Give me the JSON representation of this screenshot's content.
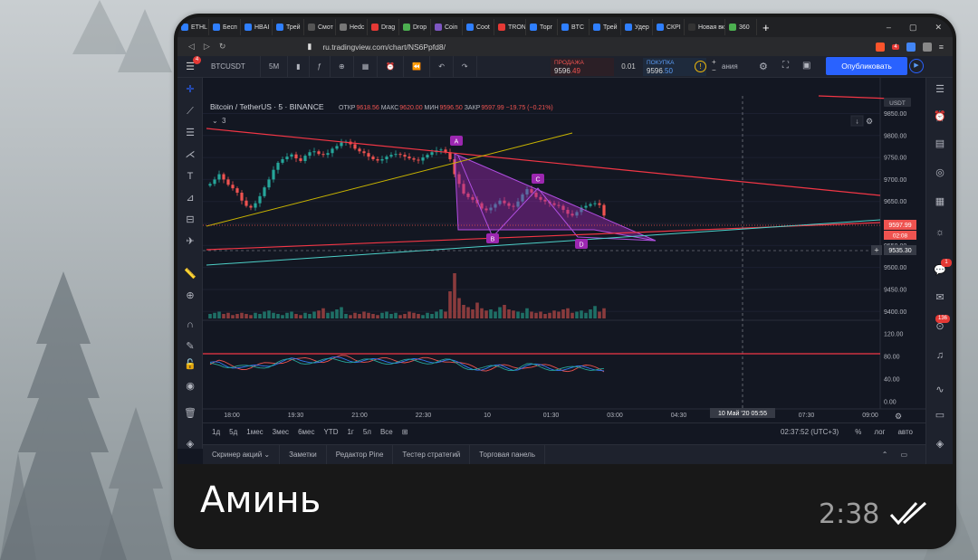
{
  "browser": {
    "tabs": [
      {
        "label": "ETHL",
        "color": "#2f7fff"
      },
      {
        "label": "Бесп",
        "color": "#2f7fff"
      },
      {
        "label": "HBAI",
        "color": "#2f7fff"
      },
      {
        "label": "Трей",
        "color": "#2f7fff"
      },
      {
        "label": "Смот",
        "color": "#555555"
      },
      {
        "label": "Hedc",
        "color": "#777777"
      },
      {
        "label": "Drag",
        "color": "#e53935"
      },
      {
        "label": "Drop",
        "color": "#4caf50"
      },
      {
        "label": "Coin",
        "color": "#7e57c2"
      },
      {
        "label": "Coot",
        "color": "#2f7fff"
      },
      {
        "label": "TRON",
        "color": "#e53935"
      },
      {
        "label": "Торг",
        "color": "#2f7fff"
      },
      {
        "label": "BTC",
        "color": "#2f7fff"
      },
      {
        "label": "Трей",
        "color": "#2f7fff"
      },
      {
        "label": "Удер",
        "color": "#2f7fff"
      },
      {
        "label": "СКРІ",
        "color": "#2f7fff"
      },
      {
        "label": "Новая вк",
        "color": "#333333"
      },
      {
        "label": "360",
        "color": "#4caf50"
      }
    ],
    "new_tab": "+",
    "url": "ru.tradingview.com/chart/NS6Ppfd8/",
    "ext_badge": "4"
  },
  "toolbar": {
    "menu_badge": "4",
    "symbol": "BTCUSDT",
    "interval": "5M",
    "sell_label": "ПРОДАЖА",
    "sell_price_main": "9596",
    "sell_price_tail": ".49",
    "spread": "0.01",
    "buy_label": "ПОКУПКА",
    "buy_price_main": "9596",
    "buy_price_tail": ".50",
    "partial_label": "ания",
    "publish_label": "Опубликовать"
  },
  "legend": {
    "title": "Bitcoin / TetherUS · 5 · BINANCE",
    "ohlc": [
      {
        "k": "ОТКР",
        "v": "9618.56"
      },
      {
        "k": "МАКС",
        "v": "9620.00"
      },
      {
        "k": "МИН",
        "v": "9596.50"
      },
      {
        "k": "ЗАКР",
        "v": "9597.99"
      }
    ],
    "change": "−19.75 (−0.21%)",
    "collapsed_count": "3"
  },
  "chart_data": {
    "type": "candlestick",
    "symbol": "BTCUSDT",
    "ylim": [
      9500,
      9890
    ],
    "price_ticks": [
      9850.0,
      9800.0,
      9750.0,
      9700.0,
      9650.0,
      9600.0,
      9550.0,
      9500.0,
      9450.0,
      9400.0
    ],
    "price_tick_labels": [
      "9850.00",
      "9800.00",
      "9750.00",
      "9700.00",
      "9650.00",
      "9600.00",
      "9550.00",
      "9500.00",
      "9450.00",
      "9400.00"
    ],
    "currency": "USDT",
    "last_price_label": "9597.99",
    "countdown_label": "02:08",
    "crosshair_price_label": "9535.30",
    "osc_ticks": [
      "120.00",
      "80.00",
      "40.00",
      "0.00"
    ],
    "time_labels": [
      "18:00",
      "19:30",
      "21:00",
      "22:30",
      "10",
      "01:30",
      "03:00",
      "04:30",
      "06:00",
      "07:30",
      "09:00"
    ],
    "crosshair_time_label": "10 Май '20   05:55",
    "pattern_points": [
      "A",
      "B",
      "C",
      "D"
    ],
    "closes": [
      9690,
      9700,
      9712,
      9700,
      9688,
      9680,
      9670,
      9652,
      9640,
      9636,
      9646,
      9662,
      9682,
      9700,
      9722,
      9738,
      9746,
      9752,
      9757,
      9748,
      9742,
      9754,
      9762,
      9764,
      9758,
      9756,
      9760,
      9770,
      9776,
      9784,
      9786,
      9780,
      9770,
      9764,
      9760,
      9752,
      9746,
      9743,
      9746,
      9752,
      9756,
      9758,
      9756,
      9752,
      9748,
      9745,
      9743,
      9750,
      9756,
      9762,
      9766,
      9768,
      9762,
      9746,
      9712,
      9690,
      9668,
      9660,
      9654,
      9646,
      9634,
      9630,
      9636,
      9644,
      9652,
      9646,
      9640,
      9638,
      9650,
      9666,
      9678,
      9670,
      9660,
      9654,
      9650,
      9646,
      9642,
      9640,
      9631,
      9622,
      9618,
      9626,
      9636,
      9640,
      9644,
      9646,
      9642,
      9618
    ],
    "volumes": [
      4,
      5,
      6,
      4,
      5,
      3,
      4,
      5,
      4,
      3,
      5,
      4,
      6,
      7,
      5,
      4,
      3,
      5,
      6,
      4,
      3,
      5,
      4,
      6,
      7,
      9,
      5,
      6,
      8,
      10,
      4,
      3,
      5,
      4,
      6,
      5,
      4,
      3,
      5,
      6,
      4,
      5,
      3,
      4,
      6,
      5,
      4,
      3,
      5,
      4,
      6,
      8,
      6,
      24,
      40,
      18,
      12,
      10,
      8,
      14,
      9,
      7,
      8,
      6,
      10,
      12,
      8,
      7,
      6,
      5,
      9,
      6,
      5,
      6,
      4,
      5,
      7,
      6,
      8,
      9,
      5,
      6,
      7,
      5,
      8,
      11,
      6,
      9
    ]
  },
  "range_bar": {
    "ranges": [
      "1д",
      "5д",
      "1мес",
      "3мес",
      "6мес",
      "YTD",
      "1г",
      "5л",
      "Все"
    ],
    "clock": "02:37:52 (UTC+3)",
    "percent": "%",
    "log": "лог",
    "auto": "авто"
  },
  "panel_tabs": [
    "Скринер акций",
    "Заметки",
    "Редактор Pine",
    "Тестер стратегий",
    "Торговая панель"
  ],
  "right_badges": {
    "chat": "1",
    "ideas": "136"
  },
  "message": {
    "text": "Аминь",
    "time": "2:38"
  },
  "colors": {
    "up": "#26a69a",
    "down": "#ef5350",
    "pattern_fill": "#9c27b0",
    "trend_red": "#f23645",
    "trend_yellow": "#c8b400",
    "trend_teal": "#4dd0c8"
  }
}
